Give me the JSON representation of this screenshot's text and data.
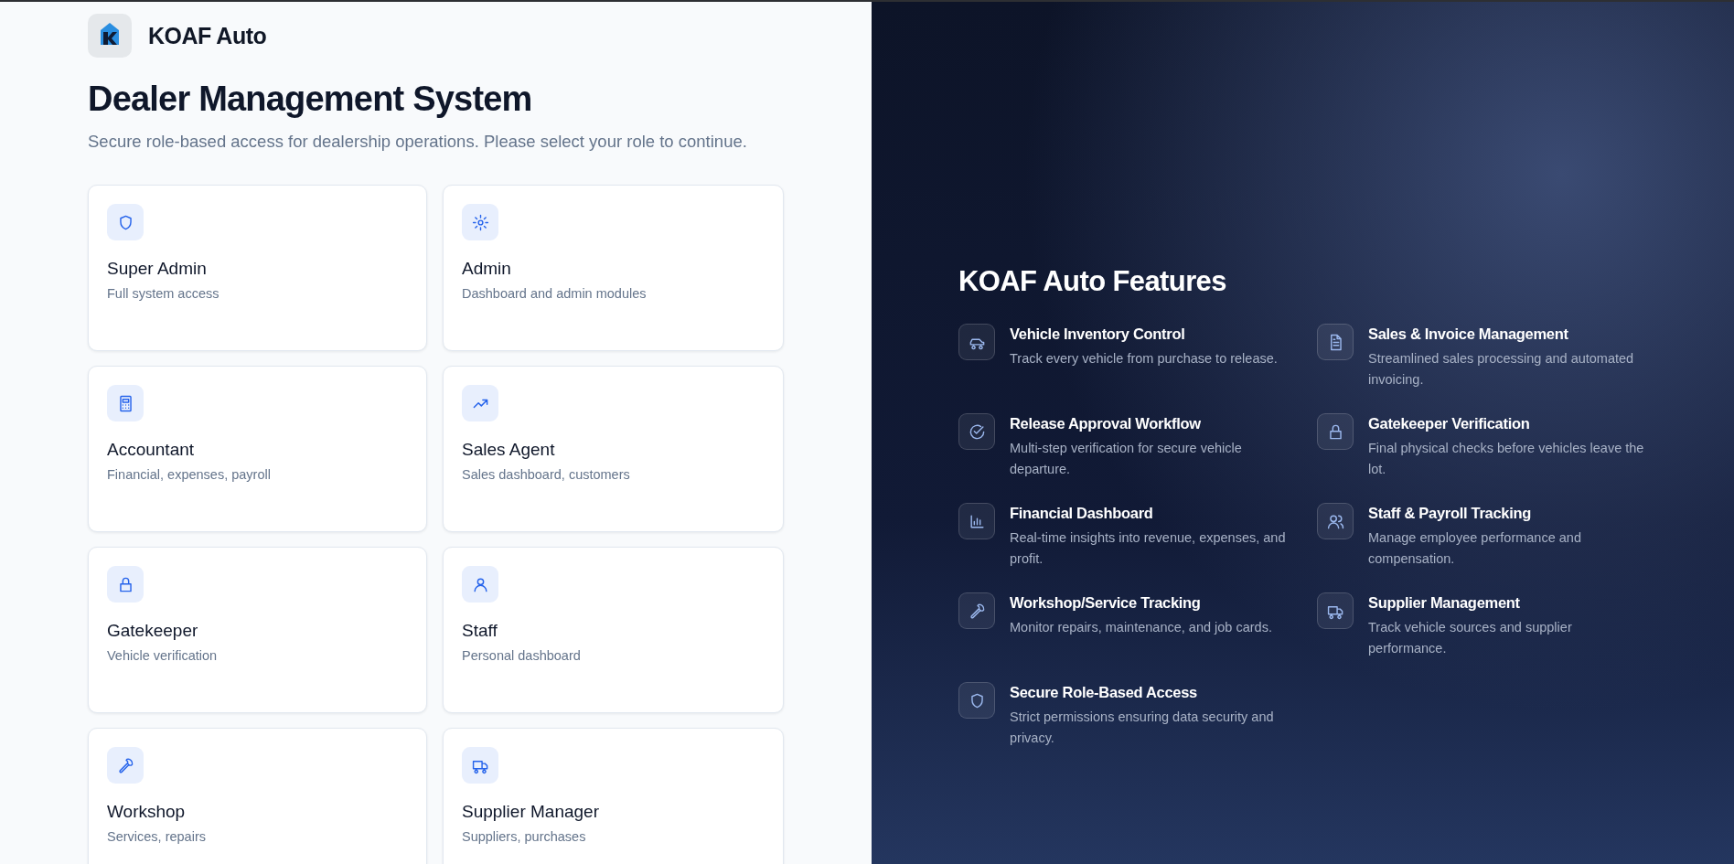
{
  "brand": {
    "name": "KOAF Auto"
  },
  "heading": "Dealer Management System",
  "subtitle": "Secure role-based access for dealership operations. Please select your role to continue.",
  "roles": [
    {
      "title": "Super Admin",
      "description": "Full system access"
    },
    {
      "title": "Admin",
      "description": "Dashboard and admin modules"
    },
    {
      "title": "Accountant",
      "description": "Financial, expenses, payroll"
    },
    {
      "title": "Sales Agent",
      "description": "Sales dashboard, customers"
    },
    {
      "title": "Gatekeeper",
      "description": "Vehicle verification"
    },
    {
      "title": "Staff",
      "description": "Personal dashboard"
    },
    {
      "title": "Workshop",
      "description": "Services, repairs"
    },
    {
      "title": "Supplier Manager",
      "description": "Suppliers, purchases"
    }
  ],
  "features_panel": {
    "title": "KOAF Auto Features",
    "features": [
      {
        "title": "Vehicle Inventory Control",
        "description": "Track every vehicle from purchase to release."
      },
      {
        "title": "Sales & Invoice Management",
        "description": "Streamlined sales processing and automated invoicing."
      },
      {
        "title": "Release Approval Workflow",
        "description": "Multi-step verification for secure vehicle departure."
      },
      {
        "title": "Gatekeeper Verification",
        "description": "Final physical checks before vehicles leave the lot."
      },
      {
        "title": "Financial Dashboard",
        "description": "Real-time insights into revenue, expenses, and profit."
      },
      {
        "title": "Staff & Payroll Tracking",
        "description": "Manage employee performance and compensation."
      },
      {
        "title": "Workshop/Service Tracking",
        "description": "Monitor repairs, maintenance, and job cards."
      },
      {
        "title": "Supplier Management",
        "description": "Track vehicle sources and supplier performance."
      },
      {
        "title": "Secure Role-Based Access",
        "description": "Strict permissions ensuring data security and privacy."
      }
    ]
  }
}
